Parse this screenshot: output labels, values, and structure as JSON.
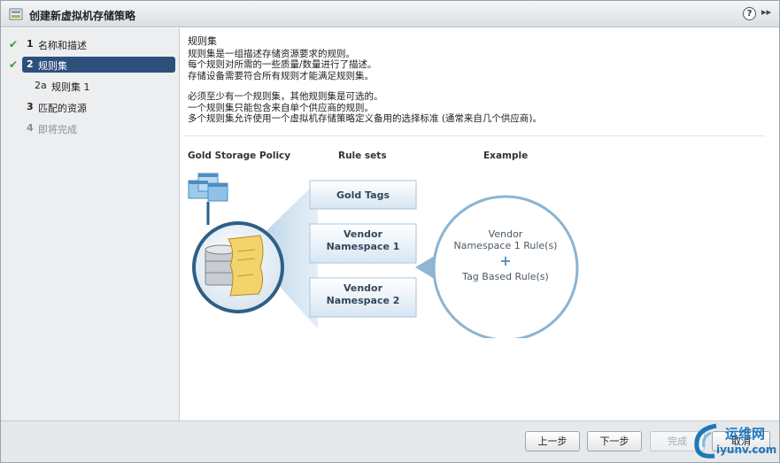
{
  "window": {
    "title": "创建新虚拟机存储策略"
  },
  "titlebar": {
    "help_label": "?",
    "expand_label": "▸▸"
  },
  "steps": [
    {
      "num": "1",
      "label": "名称和描述",
      "state": "done"
    },
    {
      "num": "2",
      "label": "规则集",
      "state": "active"
    },
    {
      "num": "2a",
      "label": "规则集 1",
      "state": "sub"
    },
    {
      "num": "3",
      "label": "匹配的资源",
      "state": "normal"
    },
    {
      "num": "4",
      "label": "即将完成",
      "state": "disabled"
    }
  ],
  "content": {
    "heading": "规则集",
    "lines1": [
      "规则集是一组描述存储资源要求的规则。",
      "每个规则对所需的一些质量/数量进行了描述。",
      "存储设备需要符合所有规则才能满足规则集。"
    ],
    "lines2": [
      "必须至少有一个规则集，其他规则集是可选的。",
      "一个规则集只能包含来自单个供应商的规则。",
      "多个规则集允许使用一个虚拟机存储策略定义备用的选择标准 (通常来自几个供应商)。"
    ]
  },
  "diagram": {
    "col1_title": "Gold Storage Policy",
    "col2_title": "Rule sets",
    "col3_title": "Example",
    "rule_sets": [
      {
        "line1": "Gold Tags",
        "line2": ""
      },
      {
        "line1": "Vendor",
        "line2": "Namespace 1"
      },
      {
        "line1": "Vendor",
        "line2": "Namespace 2"
      }
    ],
    "example": {
      "line1": "Vendor",
      "line2": "Namespace 1 Rule(s)",
      "plus": "+",
      "line3": "Tag Based Rule(s)"
    }
  },
  "footer": {
    "back_label": "上一步",
    "next_label": "下一步",
    "finish_label": "完成",
    "cancel_label": "取消"
  },
  "watermark": {
    "text_cn": "运维网",
    "text_url": "iyunv.com"
  },
  "colors": {
    "active_step": "#2d4f7c",
    "check": "#3a9a3a",
    "diagram_blue": "#6fa3c8"
  }
}
